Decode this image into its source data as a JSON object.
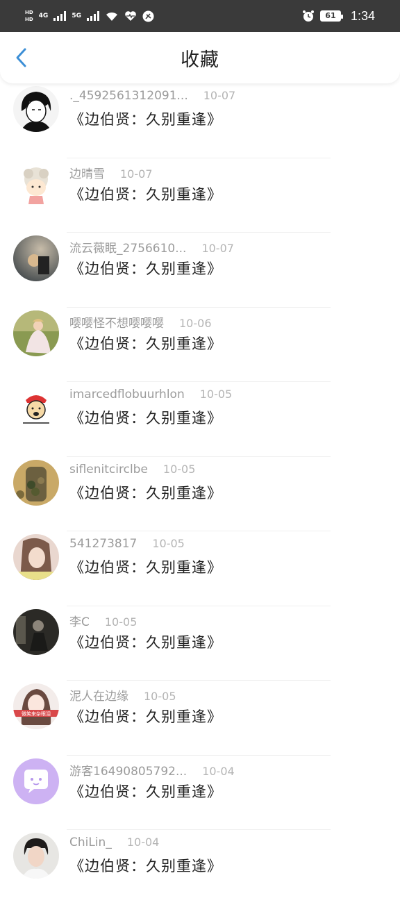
{
  "status_bar": {
    "hd1": "HD",
    "hd2": "HD",
    "net1": "4G",
    "net2": "5G",
    "battery": "61",
    "time": "1:34"
  },
  "header": {
    "title": "收藏",
    "back_icon": "chevron-left-icon",
    "accent_color": "#3c8fd6"
  },
  "items": [
    {
      "name": "._4592561312091...",
      "date": "10-07",
      "title": "《边伯贤：久别重逢》"
    },
    {
      "name": "边晴雪",
      "date": "10-07",
      "title": "《边伯贤：久别重逢》"
    },
    {
      "name": "流云薇眠_2756610...",
      "date": "10-07",
      "title": "《边伯贤：久别重逢》"
    },
    {
      "name": "嘤嘤怪不想嘤嘤嘤",
      "date": "10-06",
      "title": "《边伯贤：久别重逢》"
    },
    {
      "name": "imarcedflobuurhlon",
      "date": "10-05",
      "title": "《边伯贤：久别重逢》"
    },
    {
      "name": "siflenitcirclbe",
      "date": "10-05",
      "title": "《边伯贤：久别重逢》"
    },
    {
      "name": "541273817",
      "date": "10-05",
      "title": "《边伯贤：久别重逢》"
    },
    {
      "name": "李C",
      "date": "10-05",
      "title": "《边伯贤：久别重逢》"
    },
    {
      "name": "泥人在边缘",
      "date": "10-05",
      "title": "《边伯贤：久别重逢》"
    },
    {
      "name": "游客16490805792...",
      "date": "10-04",
      "title": "《边伯贤：久别重逢》"
    },
    {
      "name": "ChiLin_",
      "date": "10-04",
      "title": "《边伯贤：久别重逢》"
    }
  ]
}
